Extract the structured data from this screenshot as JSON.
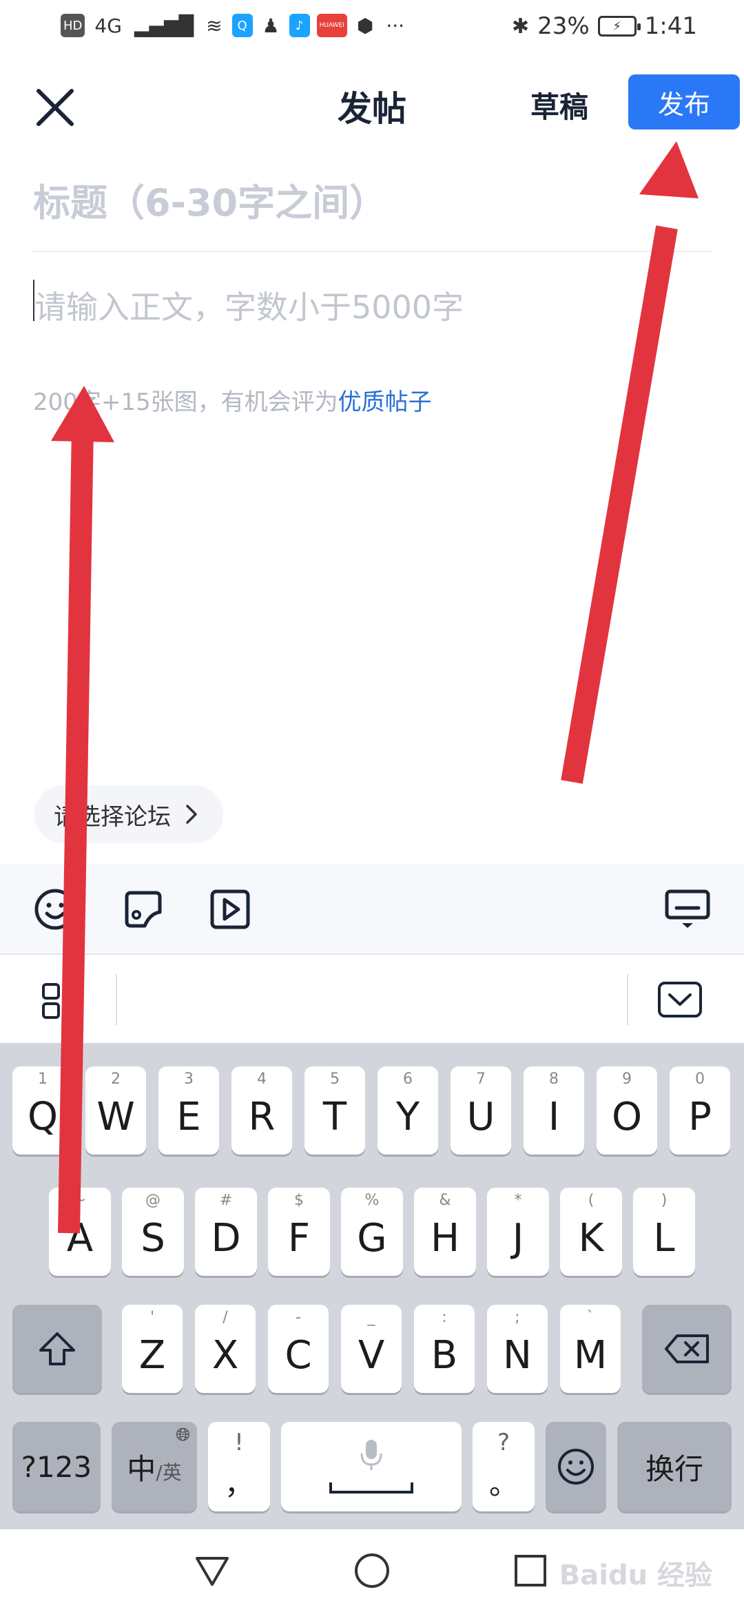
{
  "status_bar": {
    "left_items": [
      "HD",
      "4G",
      "▂▄▆█",
      "≋",
      "Q",
      "♟",
      "♪",
      "HUAWEI",
      "⬢",
      "···"
    ],
    "battery": "23%",
    "time": "1:41"
  },
  "header": {
    "title": "发帖",
    "draft_label": "草稿",
    "publish_label": "发布"
  },
  "editor": {
    "title_placeholder": "标题（6-30字之间）",
    "body_placeholder": "请输入正文，字数小于5000字",
    "hint_text": "200字+15张图，有机会评为",
    "hint_link": "优质帖子"
  },
  "forum_selector": {
    "label": "请选择论坛"
  },
  "toolbar": {
    "icons": [
      "emoji-icon",
      "image-icon",
      "video-icon",
      "keyboard-hide-icon"
    ]
  },
  "keyboard": {
    "row1": [
      {
        "k": "Q",
        "s": "1"
      },
      {
        "k": "W",
        "s": "2"
      },
      {
        "k": "E",
        "s": "3"
      },
      {
        "k": "R",
        "s": "4"
      },
      {
        "k": "T",
        "s": "5"
      },
      {
        "k": "Y",
        "s": "6"
      },
      {
        "k": "U",
        "s": "7"
      },
      {
        "k": "I",
        "s": "8"
      },
      {
        "k": "O",
        "s": "9"
      },
      {
        "k": "P",
        "s": "0"
      }
    ],
    "row2": [
      {
        "k": "A",
        "s": "~"
      },
      {
        "k": "S",
        "s": "@"
      },
      {
        "k": "D",
        "s": "#"
      },
      {
        "k": "F",
        "s": "$"
      },
      {
        "k": "G",
        "s": "%"
      },
      {
        "k": "H",
        "s": "&"
      },
      {
        "k": "J",
        "s": "*"
      },
      {
        "k": "K",
        "s": "("
      },
      {
        "k": "L",
        "s": ")"
      }
    ],
    "row3": [
      {
        "k": "Z",
        "s": "'"
      },
      {
        "k": "X",
        "s": "/"
      },
      {
        "k": "C",
        "s": "-"
      },
      {
        "k": "V",
        "s": "_"
      },
      {
        "k": "B",
        "s": ":"
      },
      {
        "k": "N",
        "s": ";"
      },
      {
        "k": "M",
        "s": "`"
      }
    ],
    "numbers_key": "?123",
    "lang_key_main": "中",
    "lang_key_sub": "/英",
    "comma_key_sub": "!",
    "comma_key": "，",
    "period_key_sub": "?",
    "period_key": "。",
    "enter_key": "换行"
  },
  "watermark": "Baidu 经验",
  "colors": {
    "accent": "#2a78f6",
    "link": "#2a6fd8",
    "arrow": "#e2343f",
    "keyboard_bg": "#d2d5dc"
  }
}
